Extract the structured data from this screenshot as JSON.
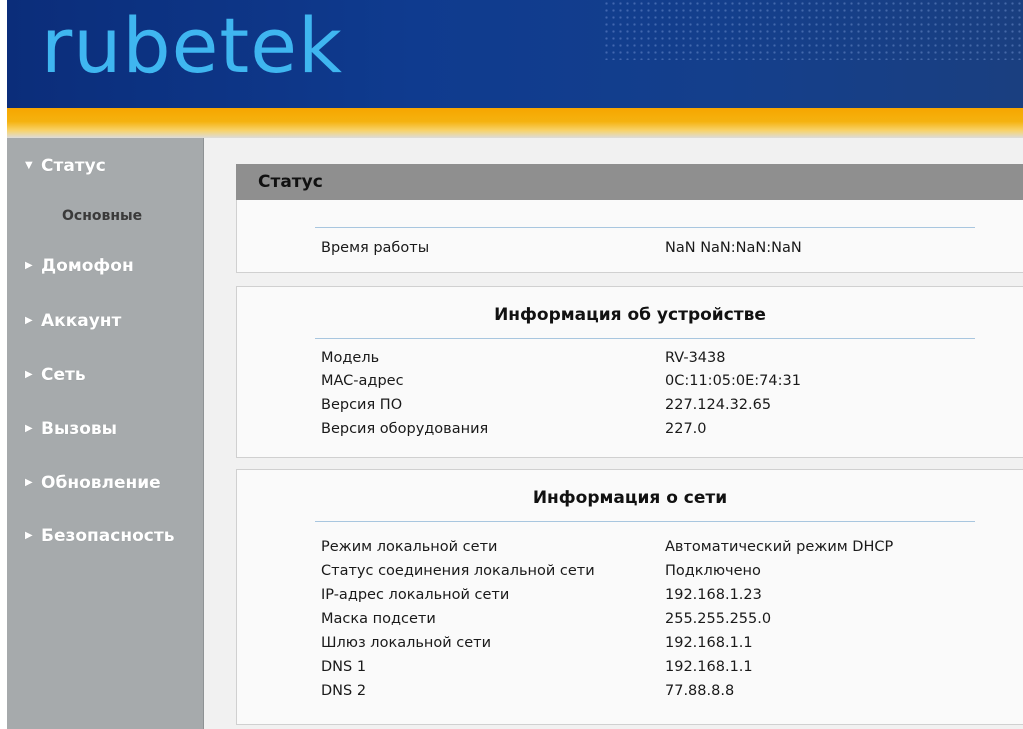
{
  "brand": {
    "logo_text": "rubetek"
  },
  "sidebar": {
    "items": [
      {
        "label": "Статус",
        "arrow": "▼"
      },
      {
        "label": "Домофон",
        "arrow": "▶"
      },
      {
        "label": "Аккаунт",
        "arrow": "▶"
      },
      {
        "label": "Сеть",
        "arrow": "▶"
      },
      {
        "label": "Вызовы",
        "arrow": "▶"
      },
      {
        "label": "Обновление",
        "arrow": "▶"
      },
      {
        "label": "Безопасность",
        "arrow": "▶"
      }
    ],
    "sub_items": [
      {
        "label": "Основные"
      }
    ]
  },
  "page": {
    "title": "Статус"
  },
  "uptime": {
    "label": "Время работы",
    "value": "NaN NaN:NaN:NaN"
  },
  "device_info": {
    "title": "Информация об устройстве",
    "rows": [
      {
        "label": "Модель",
        "value": "RV-3438"
      },
      {
        "label": "MAC-адрес",
        "value": "0C:11:05:0E:74:31"
      },
      {
        "label": "Версия ПО",
        "value": "227.124.32.65"
      },
      {
        "label": "Версия оборудования",
        "value": "227.0"
      }
    ]
  },
  "network_info": {
    "title": "Информация о сети",
    "rows": [
      {
        "label": "Режим локальной сети",
        "value": "Автоматический режим DHCP"
      },
      {
        "label": "Статус соединения локальной сети",
        "value": "Подключено"
      },
      {
        "label": "IP-адрес локальной сети",
        "value": "192.168.1.23"
      },
      {
        "label": "Маска подсети",
        "value": "255.255.255.0"
      },
      {
        "label": "Шлюз локальной сети",
        "value": "192.168.1.1"
      },
      {
        "label": "DNS 1",
        "value": "192.168.1.1"
      },
      {
        "label": "DNS 2",
        "value": "77.88.8.8"
      }
    ]
  },
  "colors": {
    "header_blue": "#0f3b8f",
    "logo_cyan": "#3fb6f0",
    "accent_orange": "#f7a600",
    "sidebar_gray": "#a6aaac",
    "title_bar_gray": "#8f8f8f"
  }
}
